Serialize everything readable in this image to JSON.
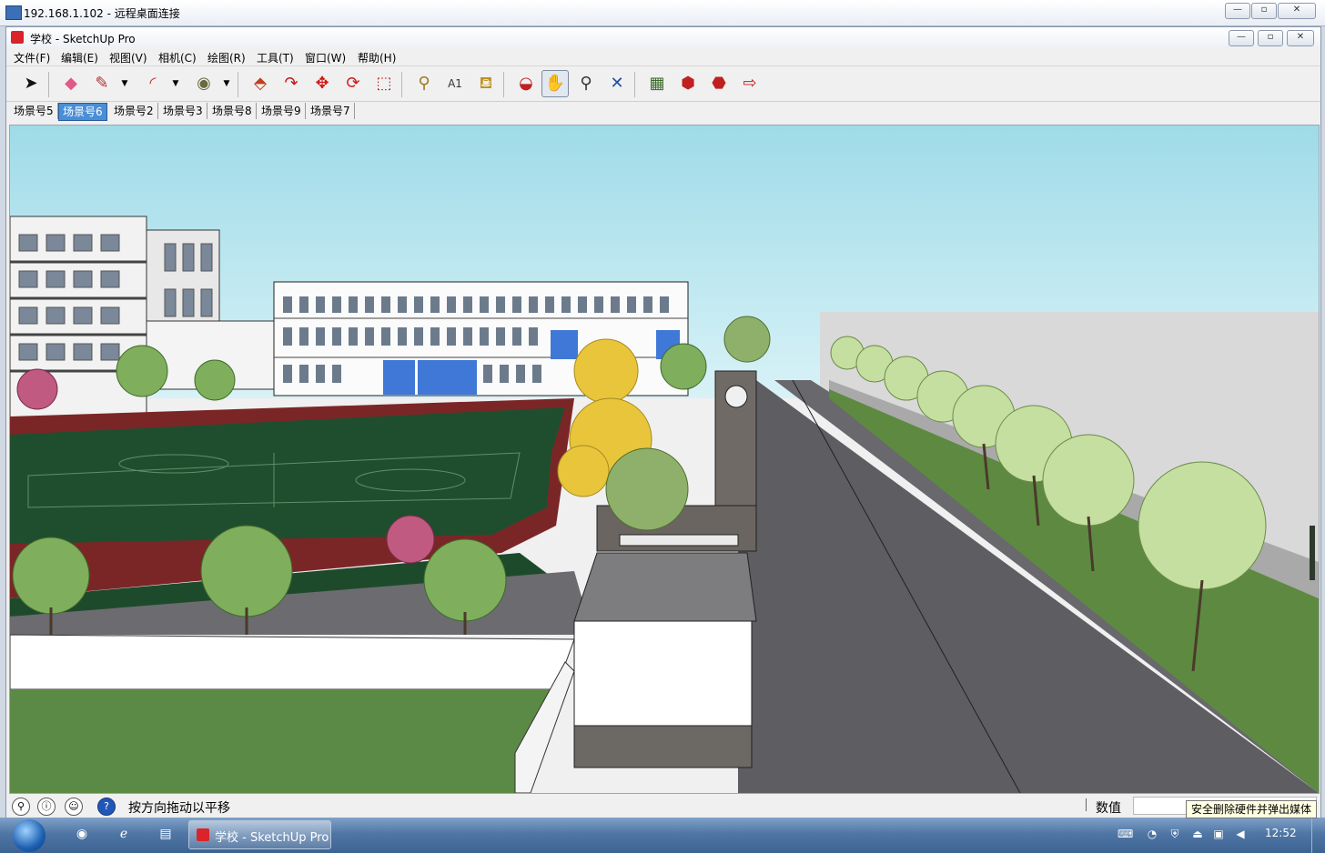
{
  "rdp": {
    "title": "192.168.1.102 - 远程桌面连接"
  },
  "app": {
    "title": "学校 - SketchUp Pro"
  },
  "menu": [
    "文件(F)",
    "编辑(E)",
    "视图(V)",
    "相机(C)",
    "绘图(R)",
    "工具(T)",
    "窗口(W)",
    "帮助(H)"
  ],
  "scenes": [
    "场景号5",
    "场景号6",
    "场景号2",
    "场景号3",
    "场景号8",
    "场景号9",
    "场景号7"
  ],
  "scene_selected": "场景号6",
  "status": {
    "hint": "按方向拖动以平移",
    "value_label": "数值",
    "value": ""
  },
  "tooltip": "安全删除硬件并弹出媒体",
  "taskbar": {
    "task": "学校 - SketchUp Pro",
    "clock": "12:52"
  },
  "icons": {
    "tools": [
      "select-arrow-icon",
      "eraser-icon",
      "pencil-icon",
      "arc-icon",
      "protractor-icon",
      "push-pull-icon",
      "follow-me-icon",
      "move-icon",
      "rotate-icon",
      "scale-icon",
      "tape-measure-icon",
      "text-icon",
      "paint-bucket-icon",
      "orbit-icon",
      "pan-hand-icon",
      "zoom-icon",
      "zoom-extents-icon",
      "map-icon",
      "component-icon",
      "warehouse-icon",
      "export-icon"
    ]
  },
  "colors": {
    "sky": "#aee3ee",
    "grass": "#6a8f45",
    "road": "#5d5d62",
    "track": "#7a2424",
    "field": "#1e4a2c",
    "accent_tab": "#4a8fd6"
  }
}
